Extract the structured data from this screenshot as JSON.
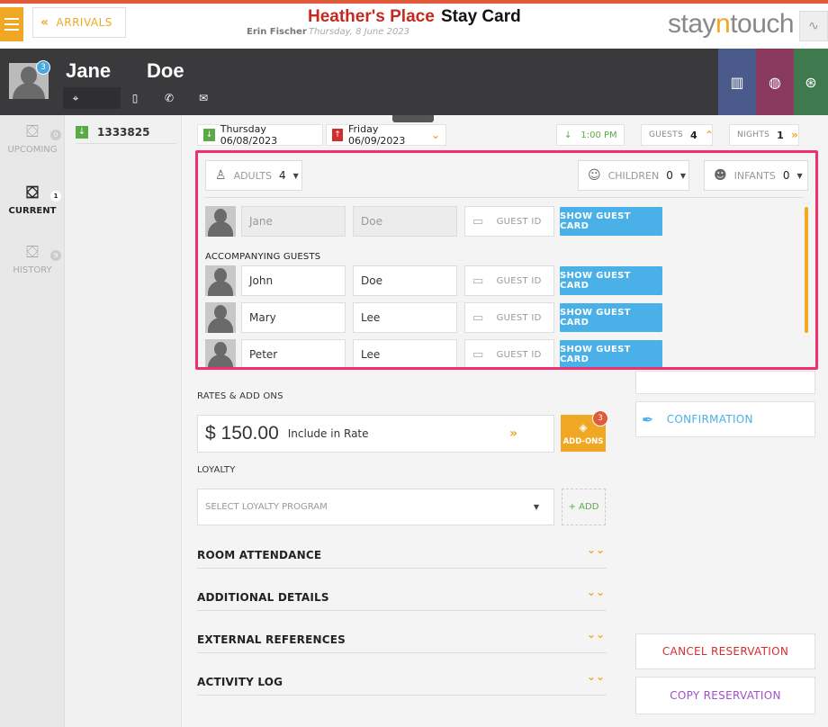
{
  "header": {
    "back_label": "ARRIVALS",
    "hotel_name": "Heather's Place",
    "page_title": "Stay Card",
    "user_name": "Erin Fischer",
    "date": "Thursday, 8 June 2023",
    "brand_pre": "stay",
    "brand_mid": "n",
    "brand_post": "touch"
  },
  "guest": {
    "first_name": "Jane",
    "last_name": "Doe",
    "avatar_badge": "3"
  },
  "nav": {
    "items": [
      {
        "label": "UPCOMING",
        "count": "0"
      },
      {
        "label": "CURRENT",
        "count": "1"
      },
      {
        "label": "HISTORY",
        "count": "9"
      }
    ]
  },
  "reservation": {
    "number": "1333825",
    "arrival": "Thursday 06/08/2023",
    "departure": "Friday 06/09/2023",
    "time": "1:00 PM",
    "guests_label": "GUESTS",
    "guests_count": "4",
    "nights_label": "NIGHTS",
    "nights_count": "1"
  },
  "guest_panel": {
    "adults_label": "ADULTS",
    "adults_count": "4",
    "children_label": "CHILDREN",
    "children_count": "0",
    "infants_label": "INFANTS",
    "infants_count": "0",
    "primary": {
      "first": "Jane",
      "last": "Doe"
    },
    "accompanying_label": "ACCOMPANYING GUESTS",
    "guest_id_label": "GUEST ID",
    "show_card_label": "SHOW GUEST CARD",
    "accompanying": [
      {
        "first": "John",
        "last": "Doe"
      },
      {
        "first": "Mary",
        "last": "Lee"
      },
      {
        "first": "Peter",
        "last": "Lee"
      }
    ]
  },
  "rates": {
    "section_label": "RATES & ADD ONS",
    "amount": "$ 150.00",
    "description": "Include in Rate",
    "addons_label": "ADD-ONS",
    "addons_count": "3"
  },
  "loyalty": {
    "section_label": "LOYALTY",
    "placeholder": "SELECT LOYALTY PROGRAM",
    "add_label": "+ ADD"
  },
  "sections": [
    {
      "label": "ROOM ATTENDANCE"
    },
    {
      "label": "ADDITIONAL DETAILS"
    },
    {
      "label": "EXTERNAL REFERENCES"
    },
    {
      "label": "ACTIVITY LOG"
    }
  ],
  "side": {
    "confirmation_label": "CONFIRMATION",
    "cancel_label": "CANCEL RESERVATION",
    "copy_label": "COPY RESERVATION"
  },
  "colors": {
    "accent": "#f0a824",
    "highlight": "#ef2f6f",
    "primary_blue": "#4ab0e8",
    "header_dark": "#3a3a3c"
  }
}
